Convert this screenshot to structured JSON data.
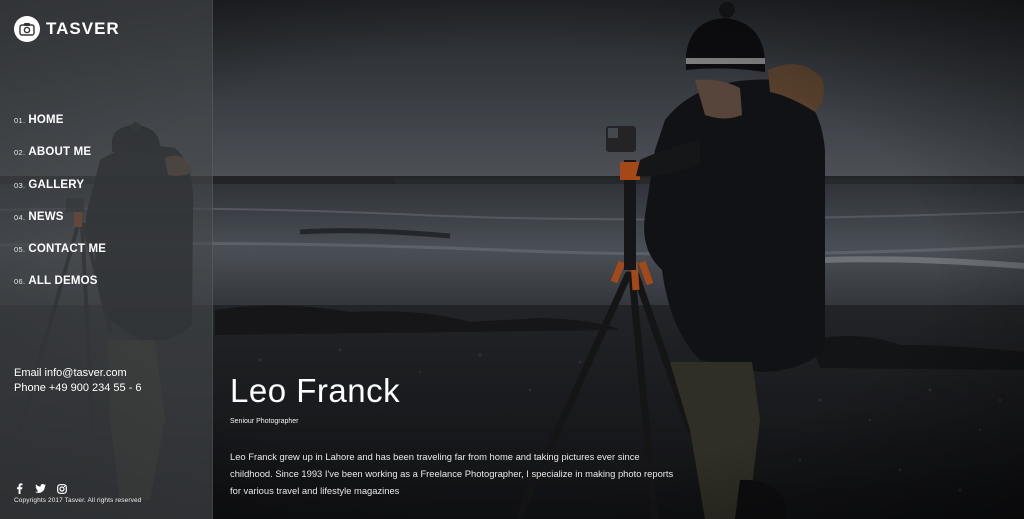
{
  "brand": {
    "name": "TASVER",
    "logo_icon": "camera-icon"
  },
  "nav": [
    {
      "num": "01.",
      "label": "HOME"
    },
    {
      "num": "02.",
      "label": "ABOUT ME"
    },
    {
      "num": "03.",
      "label": "GALLERY"
    },
    {
      "num": "04.",
      "label": "NEWS"
    },
    {
      "num": "05.",
      "label": "CONTACT ME"
    },
    {
      "num": "06.",
      "label": "ALL DEMOS"
    }
  ],
  "contact": {
    "email": "Email info@tasver.com",
    "phone": "Phone +49 900 234 55 - 6"
  },
  "social": [
    "facebook-icon",
    "twitter-icon",
    "instagram-icon"
  ],
  "copyright": "Copyrights 2017 Tasver. All rights reserved",
  "hero": {
    "name": "Leo Franck",
    "role": "Seniour Photographer",
    "bio": "Leo Franck grew up in Lahore and has been traveling far from home and taking pictures ever since childhood. Since 1993 I've been working as a Freelance Photographer, I specialize in making photo reports for various travel and lifestyle magazines"
  },
  "colors": {
    "sidebar_overlay": "#46484c",
    "text": "#ffffff",
    "tripod_accent": "#c8581e"
  }
}
